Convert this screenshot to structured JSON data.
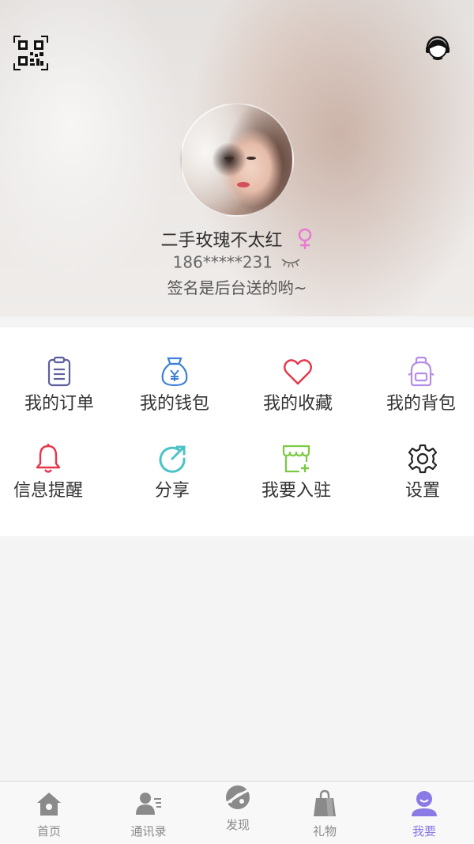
{
  "profile": {
    "username": "二手玫瑰不太红",
    "phone": "186*****231",
    "signature": "签名是后台送的哟~",
    "gender": "female"
  },
  "header_icons": {
    "qr": "qr-code-icon",
    "service": "customer-service-icon"
  },
  "menu": {
    "items": [
      {
        "label": "我的订单",
        "icon": "order-list-icon",
        "color": "#5b5f9e"
      },
      {
        "label": "我的钱包",
        "icon": "money-bag-icon",
        "color": "#3d7fd6"
      },
      {
        "label": "我的收藏",
        "icon": "heart-icon",
        "color": "#e8354a"
      },
      {
        "label": "我的背包",
        "icon": "backpack-icon",
        "color": "#b48de8"
      },
      {
        "label": "信息提醒",
        "icon": "bell-icon",
        "color": "#e8354a"
      },
      {
        "label": "分享",
        "icon": "share-icon",
        "color": "#4dc3c8"
      },
      {
        "label": "我要入驻",
        "icon": "shop-add-icon",
        "color": "#7ac943"
      },
      {
        "label": "设置",
        "icon": "gear-icon",
        "color": "#222222"
      }
    ]
  },
  "tabbar": {
    "items": [
      {
        "label": "首页",
        "icon": "home-icon",
        "active": false
      },
      {
        "label": "通讯录",
        "icon": "contacts-icon",
        "active": false
      },
      {
        "label": "发现",
        "icon": "planet-icon",
        "active": false
      },
      {
        "label": "礼物",
        "icon": "gift-bag-icon",
        "active": false
      },
      {
        "label": "我要",
        "icon": "me-icon",
        "active": true
      }
    ],
    "active_color": "#8a7ae6",
    "inactive_color": "#8a8a8a"
  }
}
